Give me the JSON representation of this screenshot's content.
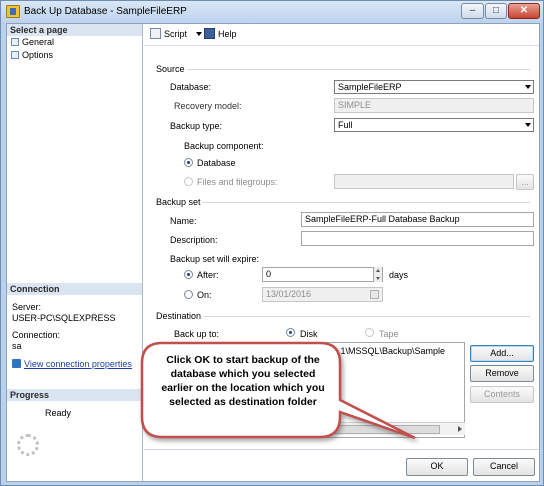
{
  "window": {
    "title": "Back Up Database - SampleFileERP",
    "controls": {
      "minimize": "–",
      "maximize": "□",
      "close": "✕"
    }
  },
  "left": {
    "select_page_header": "Select a page",
    "pages": [
      "General",
      "Options"
    ],
    "connection_header": "Connection",
    "server_label": "Server:",
    "server_value": "USER-PC\\SQLEXPRESS",
    "connection_label": "Connection:",
    "connection_value": "sa",
    "view_link": "View connection properties",
    "progress_header": "Progress",
    "progress_status": "Ready"
  },
  "toolbar": {
    "script": "Script",
    "help": "Help"
  },
  "source": {
    "group": "Source",
    "database_label": "Database:",
    "database_value": "SampleFileERP",
    "recovery_label": "Recovery model:",
    "recovery_value": "SIMPLE",
    "backup_type_label": "Backup type:",
    "backup_type_value": "Full",
    "component_label": "Backup component:",
    "component_database": "Database",
    "component_files": "Files and filegroups:",
    "ellipsis": "..."
  },
  "backup_set": {
    "group": "Backup set",
    "name_label": "Name:",
    "name_value": "SampleFileERP-Full Database Backup",
    "description_label": "Description:",
    "description_value": "",
    "expire_label": "Backup set will expire:",
    "after_label": "After:",
    "after_value": "0",
    "days_label": "days",
    "on_label": "On:",
    "on_value": "13/01/2016"
  },
  "destination": {
    "group": "Destination",
    "backup_to_label": "Back up to:",
    "disk_label": "Disk",
    "tape_label": "Tape",
    "path": "\\MSSQL.1\\MSSQL\\Backup\\Sample",
    "add": "Add...",
    "remove": "Remove",
    "contents": "Contents"
  },
  "footer": {
    "ok": "OK",
    "cancel": "Cancel"
  },
  "callout": {
    "text": "Click OK to start backup of the database which you selected earlier on the location which you selected as destination folder"
  },
  "colors": {
    "callout_border": "#c0504d",
    "callout_fill": "#ffffff",
    "link": "#1a3ea8"
  }
}
